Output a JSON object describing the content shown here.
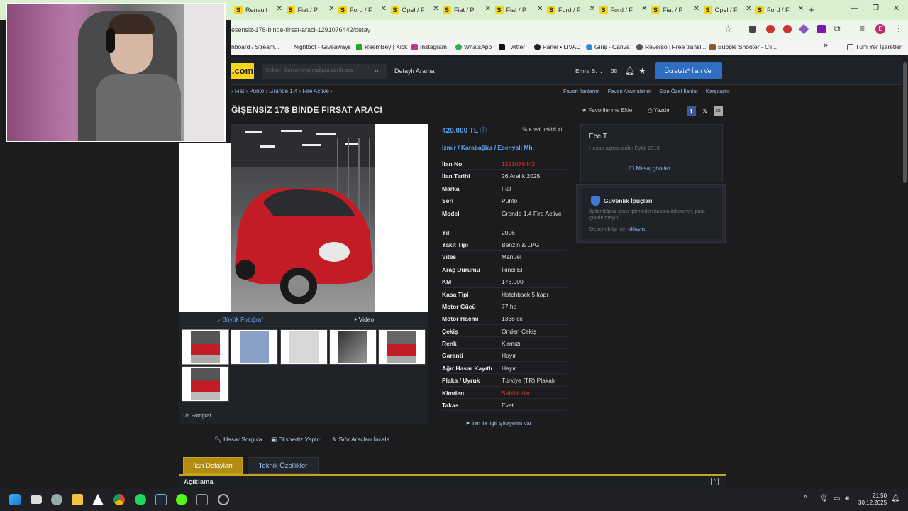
{
  "browser": {
    "tabs": [
      {
        "label": "Renault"
      },
      {
        "label": "Fiat / P"
      },
      {
        "label": "Ford / F"
      },
      {
        "label": "Opel / F"
      },
      {
        "label": "Fiat / P"
      },
      {
        "label": "Fiat / P"
      },
      {
        "label": "Ford / F"
      },
      {
        "label": "Ford / F"
      },
      {
        "label": "Fiat / P"
      },
      {
        "label": "Opel / F"
      },
      {
        "label": "Ford / F"
      }
    ],
    "tab_favicon": "S",
    "url": "esensiz-178-binde-firsat-araci-1291076442/detay",
    "bookmarks": [
      "hboard / Stream...",
      "Nightbot - Giveaways",
      "ReemBey | Kick",
      "Instagram",
      "WhatsApp",
      "Twitter",
      "Panel • LIVAD",
      "Giriş - Canva",
      "Reverso | Free transl...",
      "Bubble Shooter - Cli..."
    ],
    "all_bookmarks": "Tüm Yer İşaretleri",
    "more_bookmarks": "»"
  },
  "site": {
    "logo": ".com",
    "search_placeholder": "Kelime, ilan no veya mağaza adı ile ara",
    "advanced_search": "Detaylı Arama",
    "user": "Emre B.",
    "post_button": "Ücretsiz* İlan Ver"
  },
  "breadcrumb": "› Fiat › Punto › Grande 1.4 › Fire Active ›",
  "top_links": [
    "Favori İlanlarım",
    "Favori Aramalarım",
    "Size Özel İlanlar",
    "Karşılaştır"
  ],
  "listing": {
    "title": "ĞİŞENSİZ 178 BİNDE FIRSAT ARACI",
    "favorite": "Favorilerime Ekle",
    "print": "Yazdır",
    "big_photo": "Büyük Fotoğraf",
    "video": "Video",
    "photo_count": "1/6 Fotoğraf",
    "price": "420.000 TL",
    "credit_offer": "Kredi Teklifi Al",
    "location": "İzmir  /  Karabağlar  /  Esenyalı Mh.",
    "specs": [
      {
        "k": "İlan No",
        "v": "1291076442",
        "red": true
      },
      {
        "k": "İlan Tarihi",
        "v": "26 Aralık 2025"
      },
      {
        "k": "Marka",
        "v": "Fiat"
      },
      {
        "k": "Seri",
        "v": "Punto"
      },
      {
        "k": "Model",
        "v": "Grande 1.4 Fire Active",
        "tall": true
      },
      {
        "k": "Yıl",
        "v": "2006"
      },
      {
        "k": "Yakıt Tipi",
        "v": "Benzin & LPG"
      },
      {
        "k": "Vites",
        "v": "Manuel"
      },
      {
        "k": "Araç Durumu",
        "v": "İkinci El"
      },
      {
        "k": "KM",
        "v": "178.000"
      },
      {
        "k": "Kasa Tipi",
        "v": "Hatchback 5 kapı"
      },
      {
        "k": "Motor Gücü",
        "v": "77 hp"
      },
      {
        "k": "Motor Hacmi",
        "v": "1368 cc"
      },
      {
        "k": "Çekiş",
        "v": "Önden Çekiş"
      },
      {
        "k": "Renk",
        "v": "Kırmızı"
      },
      {
        "k": "Garanti",
        "v": "Hayır"
      },
      {
        "k": "Ağır Hasar Kayıtlı",
        "v": "Hayır"
      },
      {
        "k": "Plaka / Uyruk",
        "v": "Türkiye (TR) Plakalı"
      },
      {
        "k": "Kimden",
        "v": "Sahibinden",
        "red": true
      },
      {
        "k": "Takas",
        "v": "Evet"
      }
    ],
    "complaint": "İlan ile İlgili Şikayetim Var"
  },
  "seller": {
    "name": "Ece T.",
    "since": "Hesap açma tarihi: Eylül 2013",
    "message": "Mesaj gönder"
  },
  "safety": {
    "title": "Güvenlik İpuçları",
    "text": "İlgilendiğiniz aracı görmeden kapora ödemeyin, para göndermeyin.",
    "link_prefix": "Detaylı bilgi için",
    "link": "tıklayın."
  },
  "actions": [
    "Hasar Sorgula",
    "Ekspertiz Yaptır",
    "Sıfır Araçları İncele"
  ],
  "tabs": [
    "İlan Detayları",
    "Teknik Özellikler"
  ],
  "section_title": "Açıklama",
  "taskbar": {
    "time": "21:50",
    "date": "30.12.2025"
  },
  "colors": {
    "accent_blue": "#2e6fc4",
    "brand_yellow": "#f6d51c",
    "link_blue": "#5ea2ee",
    "red": "#e8332d"
  }
}
